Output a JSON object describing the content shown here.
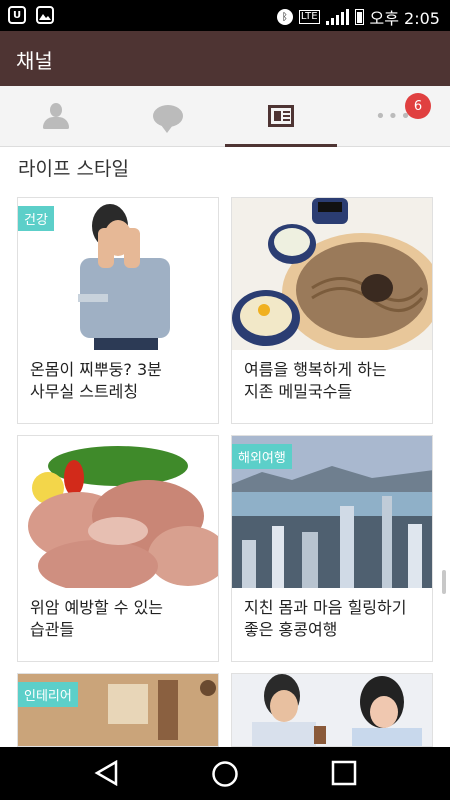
{
  "status_bar": {
    "clock": "오후 2:05",
    "network_label": "LTE",
    "app_icon_label": "U"
  },
  "app_bar": {
    "title": "채널"
  },
  "tabs": {
    "items": [
      {
        "icon": "person-icon",
        "active": false
      },
      {
        "icon": "chat-bubble-icon",
        "active": false
      },
      {
        "icon": "newspaper-icon",
        "active": true
      },
      {
        "icon": "more-dots-icon",
        "active": false,
        "badge": "6"
      }
    ]
  },
  "section": {
    "title": "라이프 스타일"
  },
  "cards": [
    {
      "tag": "건강",
      "caption_line1": "온몸이 찌뿌둥? 3분",
      "caption_line2": "사무실 스트레칭",
      "image": "man-stretching-photo"
    },
    {
      "tag": "",
      "caption_line1": "여름을 행복하게 하는",
      "caption_line2": "지존 메밀국수들",
      "image": "buckwheat-noodles-photo"
    },
    {
      "tag": "",
      "caption_line1": "위암 예방할 수 있는",
      "caption_line2": "습관들",
      "image": "sliced-meat-photo"
    },
    {
      "tag": "해외여행",
      "caption_line1": "지친 몸과 마음 힐링하기",
      "caption_line2": "좋은 홍콩여행",
      "image": "hong-kong-skyline-photo"
    },
    {
      "tag": "인테리어",
      "caption_line1": "",
      "caption_line2": "",
      "image": "interior-room-photo"
    },
    {
      "tag": "",
      "caption_line1": "",
      "caption_line2": "",
      "image": "business-people-photo"
    }
  ],
  "nav_bar": {
    "back": "back-icon",
    "home": "home-icon",
    "recents": "recents-icon"
  }
}
